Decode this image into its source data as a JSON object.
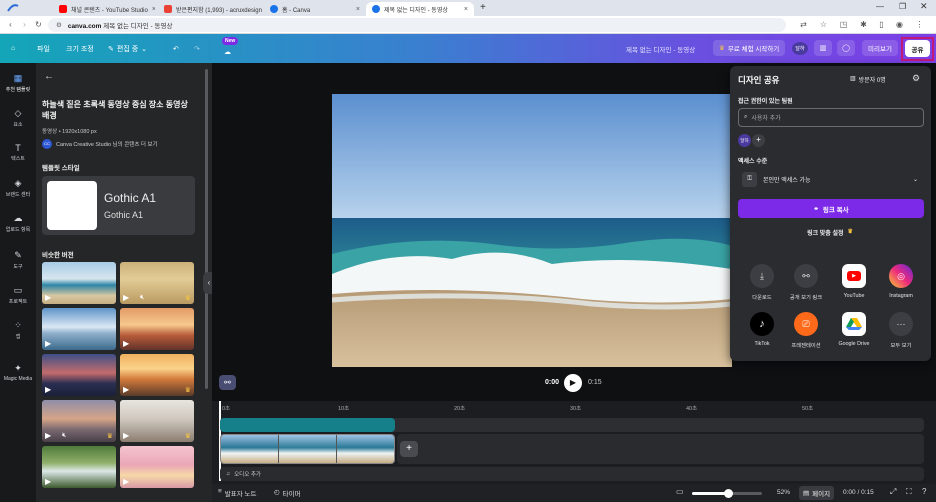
{
  "browser": {
    "tabs": [
      {
        "title": "채널 콘텐츠 - YouTube Studio",
        "color": "#ff0000"
      },
      {
        "title": "받은편지함 (1,993) - acruxdesign",
        "color": "#ea4335"
      },
      {
        "title": "홈 - Canva",
        "color": "#1a73e8"
      },
      {
        "title": "제목 없는 디자인 - 동영상",
        "color": "#1a73e8"
      }
    ],
    "url_host": "canva.com",
    "url_rest": "제목 없는 디자인 - 동영상"
  },
  "header": {
    "file": "파일",
    "resize": "크기 조정",
    "edit": "편집 중",
    "new_badge": "New",
    "doc_title": "제목 없는 디자인 - 동영상",
    "trial": "무료 체험 시작하기",
    "avatar": "달하",
    "preview": "미리보기",
    "share": "공유"
  },
  "rail": [
    {
      "label": "추천 템플릿",
      "icon": "▦"
    },
    {
      "label": "요소",
      "icon": "◇"
    },
    {
      "label": "텍스트",
      "icon": "T"
    },
    {
      "label": "브랜드 센터",
      "icon": "◈"
    },
    {
      "label": "업로드 항목",
      "icon": "☁"
    },
    {
      "label": "도구",
      "icon": "✎"
    },
    {
      "label": "프로젝트",
      "icon": "▭"
    },
    {
      "label": "앱",
      "icon": "⁘"
    },
    {
      "label": "Magic Media",
      "icon": "✦"
    }
  ],
  "panel": {
    "title": "하늘색 짙은 초록색 동영상 중심 장소 동영상 배경",
    "meta": "동영상 • 1920x1080 px",
    "author": "Canva Creative Studio 님의 콘텐츠 더 보기",
    "style_heading": "템플릿 스타일",
    "font_main": "Gothic A1",
    "font_sub": "Gothic A1",
    "similar_heading": "비슷한 버전"
  },
  "canvas": {
    "current_time": "0:00",
    "duration": "0:15"
  },
  "timeline": {
    "ticks": [
      "0초",
      "10초",
      "20초",
      "30초",
      "40초",
      "50초"
    ],
    "audio_add": "오디오 추가"
  },
  "footer": {
    "notes": "발표자 노트",
    "timer": "타이머",
    "zoom": "52%",
    "pages": "페이지",
    "time": "0:00 / 0:15",
    "zoom_level": 0.52
  },
  "share": {
    "title": "디자인 공유",
    "visitors": "방문자 0명",
    "people_label": "접근 권한이 있는 팀원",
    "people_placeholder": "사용자 추가",
    "avatar": "달하",
    "access_label": "액세스 수준",
    "access_value": "본인만 액세스 가능",
    "copy_link": "링크 복사",
    "link_settings": "링크 맞춤 설정",
    "apps": [
      {
        "label": "다운로드",
        "icon": "download-icon"
      },
      {
        "label": "공개 보기 링크",
        "icon": "link-icon"
      },
      {
        "label": "YouTube",
        "icon": "youtube-icon"
      },
      {
        "label": "Instagram",
        "icon": "instagram-icon"
      },
      {
        "label": "TikTok",
        "icon": "tiktok-icon"
      },
      {
        "label": "프레젠테이션",
        "icon": "present-icon"
      },
      {
        "label": "Google Drive",
        "icon": "drive-icon"
      },
      {
        "label": "모두 보기",
        "icon": "more-icon"
      }
    ]
  },
  "colors": {
    "accent": "#7d2ae8",
    "share_border": "#c0197a"
  }
}
